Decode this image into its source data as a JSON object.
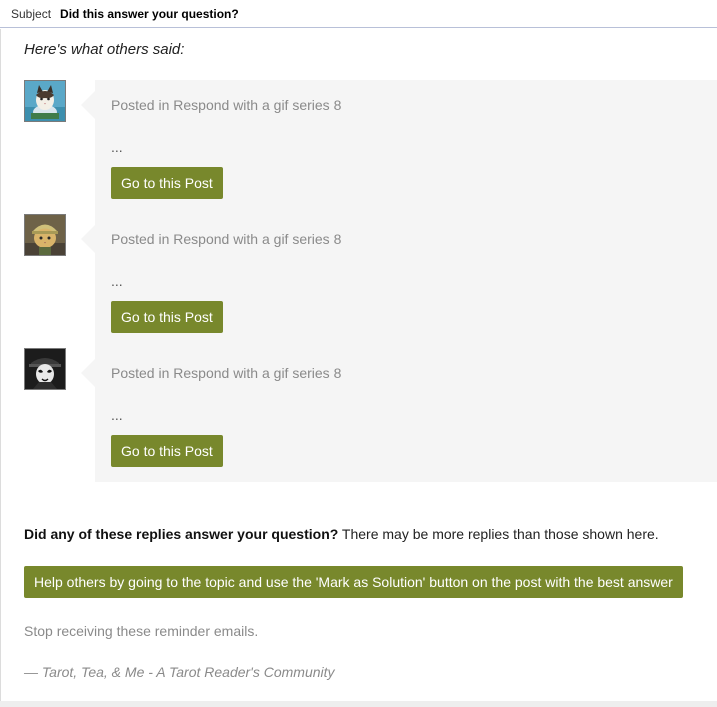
{
  "subject": {
    "label": "Subject",
    "value": "Did this answer your question?"
  },
  "intro": "Here's what others said:",
  "replies": [
    {
      "avatar": "cat-in-cup-avatar",
      "posted": "Posted in Respond with a gif series 8",
      "excerpt": "...",
      "button_label": "Go to this Post"
    },
    {
      "avatar": "cat-with-helmet-avatar",
      "posted": "Posted in Respond with a gif series 8",
      "excerpt": "...",
      "button_label": "Go to this Post"
    },
    {
      "avatar": "masked-figure-avatar",
      "posted": "Posted in Respond with a gif series 8",
      "excerpt": "...",
      "button_label": "Go to this Post"
    }
  ],
  "question": {
    "bold": "Did any of these replies answer your question?",
    "rest": " There may be more replies than those shown here."
  },
  "solution_button": "Help others by going to the topic and use the 'Mark as Solution' button on the post with the best answer",
  "stop_link": "Stop receiving these reminder emails.",
  "signature": "— Tarot, Tea, & Me - A Tarot Reader's Community",
  "colors": {
    "button_green": "#78882c",
    "panel_gray": "#f5f5f5",
    "muted_text": "#8a8a8a"
  }
}
